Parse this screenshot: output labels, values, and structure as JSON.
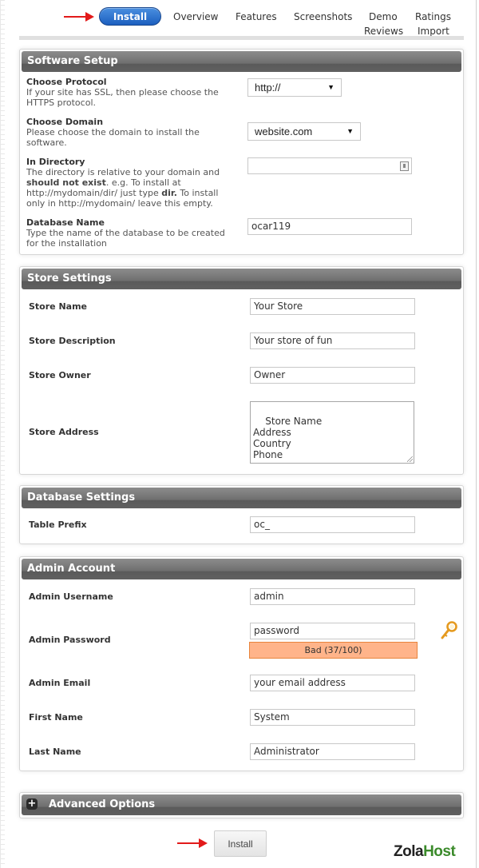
{
  "nav": {
    "install_label": "Install",
    "links": [
      "Overview",
      "Features",
      "Screenshots",
      "Demo",
      "Ratings",
      "Reviews",
      "Import"
    ]
  },
  "software_setup": {
    "title": "Software Setup",
    "protocol": {
      "label": "Choose Protocol",
      "desc": "If your site has SSL, then please choose the HTTPS protocol.",
      "value": "http://"
    },
    "domain": {
      "label": "Choose Domain",
      "desc": "Please choose the domain to install the software.",
      "value": "website.com"
    },
    "directory": {
      "label": "In Directory",
      "desc_1": "The directory is relative to your domain and",
      "desc_bold_1": "should not exist",
      "desc_2": ". e.g. To install at http://mydomain/dir/ just type",
      "desc_bold_2": "dir.",
      "desc_3": "To install only in http://mydomain/ leave this empty.",
      "value": ""
    },
    "database": {
      "label": "Database Name",
      "desc": "Type the name of the database to be created for the installation",
      "value": "ocar119"
    }
  },
  "store_settings": {
    "title": "Store Settings",
    "store_name": {
      "label": "Store Name",
      "value": "Your Store"
    },
    "store_description": {
      "label": "Store Description",
      "value": "Your store of fun"
    },
    "store_owner": {
      "label": "Store Owner",
      "value": "Owner"
    },
    "store_address": {
      "label": "Store Address",
      "value": "Store Name\nAddress\nCountry\nPhone"
    }
  },
  "database_settings": {
    "title": "Database Settings",
    "table_prefix": {
      "label": "Table Prefix",
      "value": "oc_"
    }
  },
  "admin_account": {
    "title": "Admin Account",
    "username": {
      "label": "Admin Username",
      "value": "admin"
    },
    "password": {
      "label": "Admin Password",
      "value": "password",
      "strength_text": "Bad (37/100)",
      "strength_score": 37
    },
    "email": {
      "label": "Admin Email",
      "value": "your email address"
    },
    "first_name": {
      "label": "First Name",
      "value": "System"
    },
    "last_name": {
      "label": "Last Name",
      "value": "Administrator"
    }
  },
  "advanced_options": {
    "title": "Advanced Options"
  },
  "footer": {
    "install_button": "Install",
    "brand_part1": "Zola",
    "brand_part2": "Host"
  },
  "colors": {
    "accent_blue": "#1c5fbf",
    "arrow_red": "#e21a1a",
    "strength_bad": "#ffb48a",
    "brand_green": "#3a8a2a"
  }
}
